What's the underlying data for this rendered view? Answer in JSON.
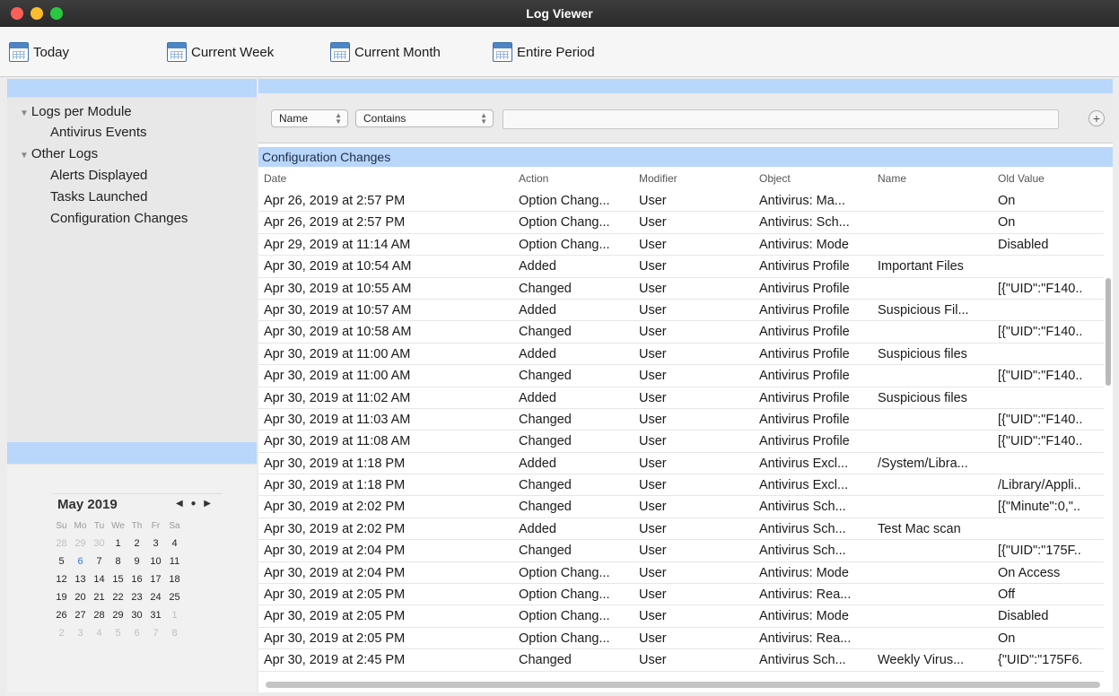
{
  "window": {
    "title": "Log Viewer"
  },
  "toolbar": {
    "buttons": [
      {
        "label": "Today",
        "icon": "calendar-icon"
      },
      {
        "label": "Current Week",
        "icon": "calendar-icon"
      },
      {
        "label": "Current Month",
        "icon": "calendar-icon"
      },
      {
        "label": "Entire Period",
        "icon": "calendar-icon"
      }
    ]
  },
  "sidebar": {
    "groups": [
      {
        "label": "Logs per Module",
        "items": [
          "Antivirus Events"
        ]
      },
      {
        "label": "Other Logs",
        "items": [
          "Alerts Displayed",
          "Tasks Launched",
          "Configuration Changes"
        ]
      }
    ],
    "selected": "Configuration Changes"
  },
  "calendar": {
    "month_label": "May 2019",
    "nav": "◀ ● ▶",
    "weekdays": [
      "Su",
      "Mo",
      "Tu",
      "We",
      "Th",
      "Fr",
      "Sa"
    ],
    "weeks": [
      [
        "28",
        "29",
        "30",
        "1",
        "2",
        "3",
        "4"
      ],
      [
        "5",
        "6",
        "7",
        "8",
        "9",
        "10",
        "11"
      ],
      [
        "12",
        "13",
        "14",
        "15",
        "16",
        "17",
        "18"
      ],
      [
        "19",
        "20",
        "21",
        "22",
        "23",
        "24",
        "25"
      ],
      [
        "26",
        "27",
        "28",
        "29",
        "30",
        "31",
        "1"
      ],
      [
        "2",
        "3",
        "4",
        "5",
        "6",
        "7",
        "8"
      ]
    ],
    "today": "6"
  },
  "filter": {
    "field": "Name",
    "operator": "Contains",
    "value": "",
    "add_label": "+"
  },
  "table": {
    "title": "Configuration Changes",
    "columns": [
      "Date",
      "Action",
      "Modifier",
      "Object",
      "Name",
      "Old Value"
    ],
    "rows": [
      [
        "Apr 26, 2019 at 2:57 PM",
        "Option Chang...",
        "User",
        "Antivirus: Ma...",
        "",
        "On"
      ],
      [
        "Apr 26, 2019 at 2:57 PM",
        "Option Chang...",
        "User",
        "Antivirus: Sch...",
        "",
        "On"
      ],
      [
        "Apr 29, 2019 at 11:14 AM",
        "Option Chang...",
        "User",
        "Antivirus: Mode",
        "",
        "Disabled"
      ],
      [
        "Apr 30, 2019 at 10:54 AM",
        "Added",
        "User",
        "Antivirus Profile",
        "Important Files",
        ""
      ],
      [
        "Apr 30, 2019 at 10:55 AM",
        "Changed",
        "User",
        "Antivirus Profile",
        "",
        "[{\"UID\":\"F140.."
      ],
      [
        "Apr 30, 2019 at 10:57 AM",
        "Added",
        "User",
        "Antivirus Profile",
        "Suspicious Fil...",
        ""
      ],
      [
        "Apr 30, 2019 at 10:58 AM",
        "Changed",
        "User",
        "Antivirus Profile",
        "",
        "[{\"UID\":\"F140.."
      ],
      [
        "Apr 30, 2019 at 11:00 AM",
        "Added",
        "User",
        "Antivirus Profile",
        "Suspicious files",
        ""
      ],
      [
        "Apr 30, 2019 at 11:00 AM",
        "Changed",
        "User",
        "Antivirus Profile",
        "",
        "[{\"UID\":\"F140.."
      ],
      [
        "Apr 30, 2019 at 11:02 AM",
        "Added",
        "User",
        "Antivirus Profile",
        "Suspicious files",
        ""
      ],
      [
        "Apr 30, 2019 at 11:03 AM",
        "Changed",
        "User",
        "Antivirus Profile",
        "",
        "[{\"UID\":\"F140.."
      ],
      [
        "Apr 30, 2019 at 11:08 AM",
        "Changed",
        "User",
        "Antivirus Profile",
        "",
        "[{\"UID\":\"F140.."
      ],
      [
        "Apr 30, 2019 at 1:18 PM",
        "Added",
        "User",
        "Antivirus Excl...",
        "/System/Libra...",
        ""
      ],
      [
        "Apr 30, 2019 at 1:18 PM",
        "Changed",
        "User",
        "Antivirus Excl...",
        "",
        "/Library/Appli.."
      ],
      [
        "Apr 30, 2019 at 2:02 PM",
        "Changed",
        "User",
        "Antivirus Sch...",
        "",
        "[{\"Minute\":0,\".."
      ],
      [
        "Apr 30, 2019 at 2:02 PM",
        "Added",
        "User",
        "Antivirus Sch...",
        "Test Mac scan",
        ""
      ],
      [
        "Apr 30, 2019 at 2:04 PM",
        "Changed",
        "User",
        "Antivirus Sch...",
        "",
        "[{\"UID\":\"175F.."
      ],
      [
        "Apr 30, 2019 at 2:04 PM",
        "Option Chang...",
        "User",
        "Antivirus: Mode",
        "",
        "On Access"
      ],
      [
        "Apr 30, 2019 at 2:05 PM",
        "Option Chang...",
        "User",
        "Antivirus: Rea...",
        "",
        "Off"
      ],
      [
        "Apr 30, 2019 at 2:05 PM",
        "Option Chang...",
        "User",
        "Antivirus: Mode",
        "",
        "Disabled"
      ],
      [
        "Apr 30, 2019 at 2:05 PM",
        "Option Chang...",
        "User",
        "Antivirus: Rea...",
        "",
        "On"
      ],
      [
        "Apr 30, 2019 at 2:45 PM",
        "Changed",
        "User",
        "Antivirus Sch...",
        "Weekly Virus...",
        "{\"UID\":\"175F6."
      ]
    ]
  }
}
